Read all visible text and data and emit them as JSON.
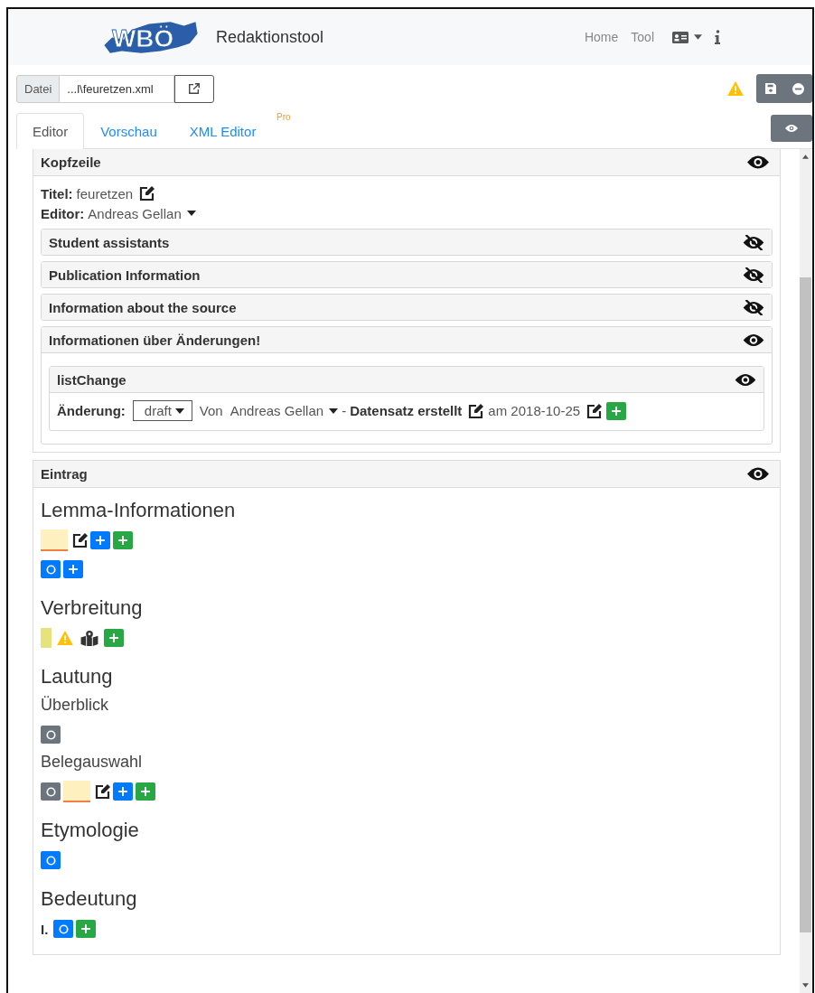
{
  "header": {
    "logo": "WBÖ",
    "title": "Redaktionstool",
    "nav": [
      {
        "label": "Home"
      },
      {
        "label": "Tool"
      }
    ]
  },
  "file_bar": {
    "label": "Datei",
    "value": "...l\\feuretzen.xml"
  },
  "tabs": [
    {
      "label": "Editor",
      "selected": true
    },
    {
      "label": "Vorschau",
      "selected": false
    },
    {
      "label": "XML Editor",
      "selected": false,
      "badge": "Pro"
    }
  ],
  "kopfzeile": {
    "title": "Kopfzeile",
    "visible": true,
    "fields": [
      {
        "label": "Titel:",
        "value": "feuretzen",
        "kind": "edit"
      },
      {
        "label": "Editor:",
        "value": "Andreas Gellan",
        "kind": "dropdown"
      }
    ],
    "sections": [
      {
        "title": "Student assistants",
        "visible": false
      },
      {
        "title": "Publication Information",
        "visible": false
      },
      {
        "title": "Information about the source",
        "visible": false
      },
      {
        "title": "Informationen über Änderungen!",
        "visible": true,
        "list": {
          "title": "listChange",
          "visible": true,
          "change": {
            "label": "Änderung:",
            "status": "draft",
            "von": "Von",
            "person": "Andreas Gellan",
            "dash": "-",
            "action": "Datensatz erstellt",
            "date": "am 2018-10-25"
          }
        }
      }
    ]
  },
  "eintrag": {
    "title": "Eintrag",
    "visible": true,
    "blocks": [
      {
        "kind": "heading",
        "text": "Lemma-Informationen"
      },
      {
        "kind": "controls",
        "controls": [
          {
            "kind": "field"
          },
          {
            "kind": "edit"
          },
          {
            "kind": "plus-blue"
          },
          {
            "kind": "plus-green"
          }
        ]
      },
      {
        "kind": "controls",
        "controls": [
          {
            "kind": "refresh-blue"
          },
          {
            "kind": "plus-blue"
          }
        ]
      },
      {
        "kind": "heading",
        "text": "Verbreitung"
      },
      {
        "kind": "controls",
        "controls": [
          {
            "kind": "bar"
          },
          {
            "kind": "warning"
          },
          {
            "kind": "map"
          },
          {
            "kind": "plus-green"
          }
        ]
      },
      {
        "kind": "heading",
        "text": "Lautung"
      },
      {
        "kind": "subheading",
        "text": "Überblick"
      },
      {
        "kind": "controls",
        "controls": [
          {
            "kind": "refresh-gray"
          }
        ]
      },
      {
        "kind": "subheading",
        "text": "Belegauswahl"
      },
      {
        "kind": "controls",
        "controls": [
          {
            "kind": "refresh-gray"
          },
          {
            "kind": "field"
          },
          {
            "kind": "edit"
          },
          {
            "kind": "plus-blue"
          },
          {
            "kind": "plus-green"
          }
        ]
      },
      {
        "kind": "heading",
        "text": "Etymologie"
      },
      {
        "kind": "controls",
        "controls": [
          {
            "kind": "refresh-blue"
          }
        ]
      },
      {
        "kind": "heading",
        "text": "Bedeutung"
      },
      {
        "kind": "controls",
        "controls": [
          {
            "kind": "label",
            "text": "I."
          },
          {
            "kind": "refresh-blue"
          },
          {
            "kind": "plus-green"
          }
        ]
      }
    ]
  }
}
